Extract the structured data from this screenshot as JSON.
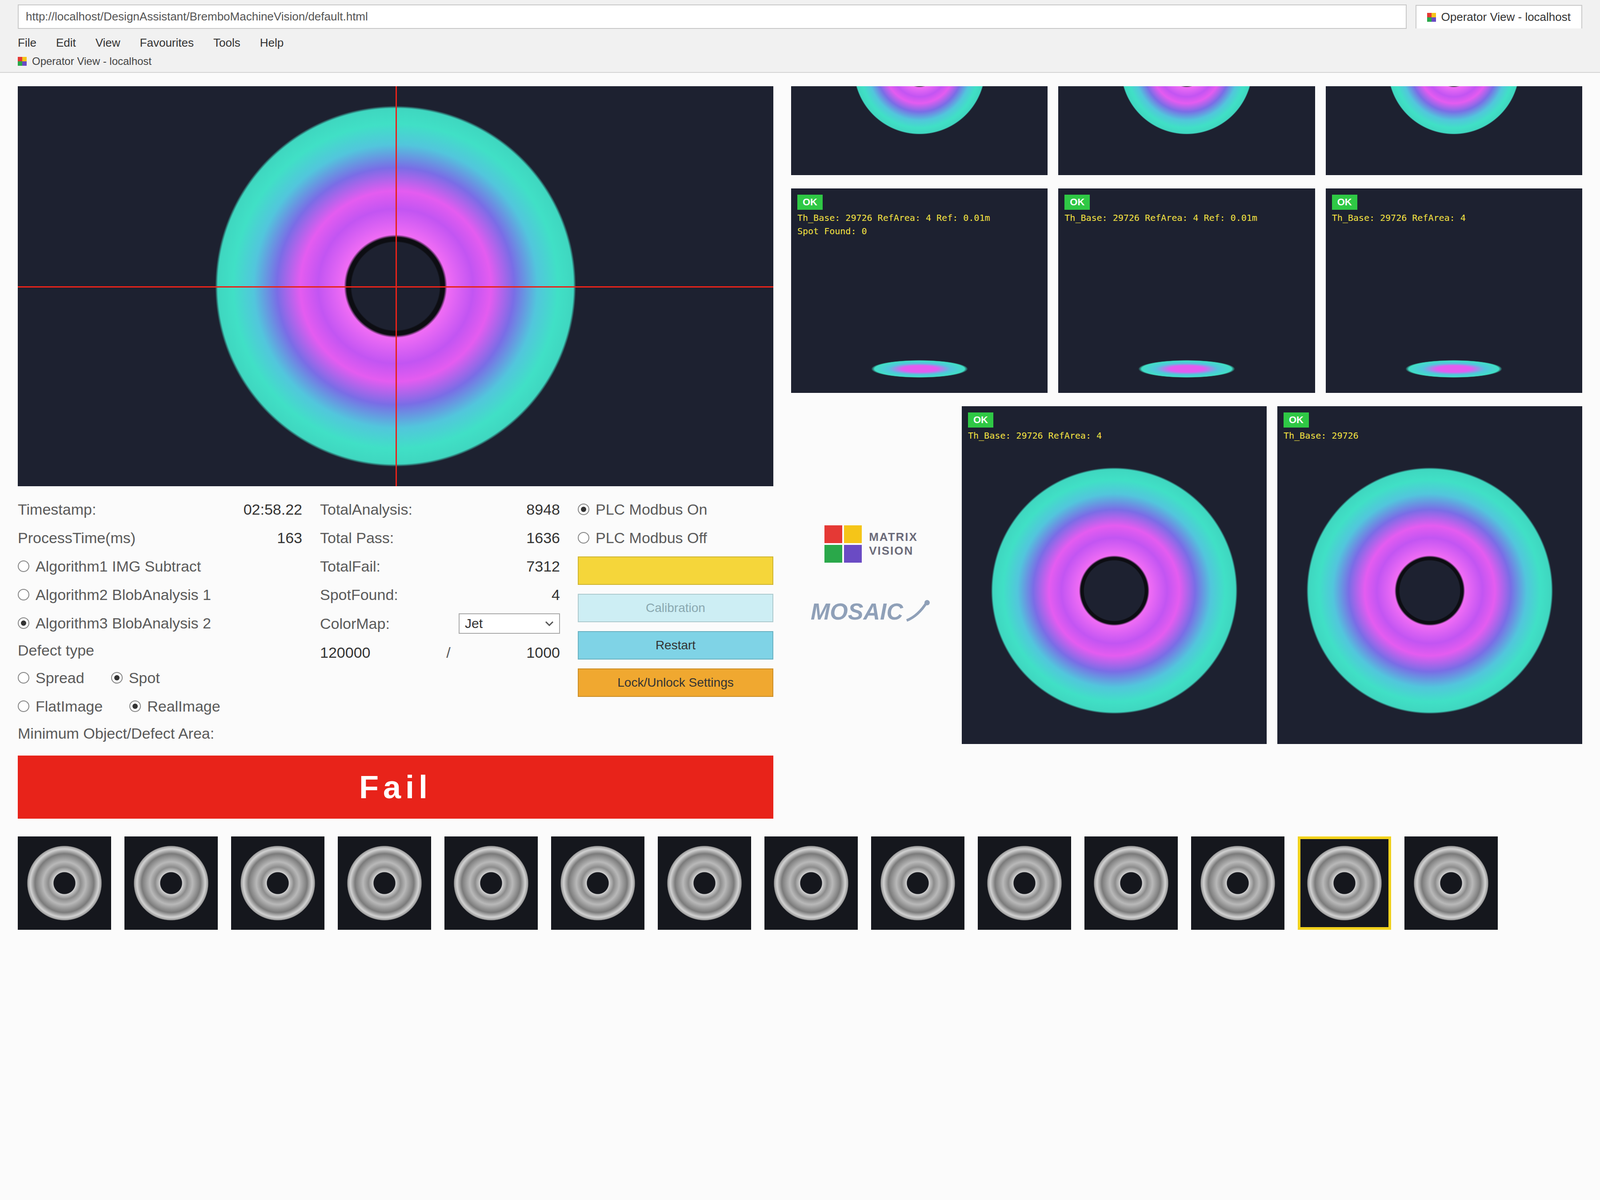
{
  "browser": {
    "address": "http://localhost/DesignAssistant/BremboMachineVision/default.html",
    "tab": "Operator View - localhost",
    "menu": [
      "File",
      "Edit",
      "View",
      "Favourites",
      "Tools",
      "Help"
    ],
    "favorite": "Operator View - localhost"
  },
  "status": [
    {
      "label": "Timestamp:",
      "value": "02:58.22"
    },
    {
      "label": "ProcessTime(ms)",
      "value": "163"
    }
  ],
  "algorithms": [
    {
      "label": "Algorithm1 IMG Subtract",
      "selected": false
    },
    {
      "label": "Algorithm2 BlobAnalysis 1",
      "selected": false
    },
    {
      "label": "Algorithm3 BlobAnalysis 2",
      "selected": true
    }
  ],
  "defect_type": {
    "label": "Defect type",
    "options": [
      {
        "label": "Spread",
        "selected": false
      },
      {
        "label": "Spot",
        "selected": true
      }
    ]
  },
  "image_type": [
    {
      "label": "FlatImage",
      "selected": false
    },
    {
      "label": "RealImage",
      "selected": true
    }
  ],
  "min_area_label": "Minimum Object/Defect Area:",
  "totals": [
    {
      "label": "TotalAnalysis:",
      "value": "8948"
    },
    {
      "label": "Total Pass:",
      "value": "1636"
    },
    {
      "label": "TotalFail:",
      "value": "7312"
    }
  ],
  "spot_found": {
    "label": "SpotFound:",
    "value": "4"
  },
  "color_map": {
    "label": "ColorMap:",
    "value": "Jet"
  },
  "area_values": {
    "max": "120000",
    "separator": "/",
    "min": "1000"
  },
  "plc": [
    {
      "label": "PLC Modbus On",
      "selected": true
    },
    {
      "label": "PLC Modbus Off",
      "selected": false
    }
  ],
  "buttons": [
    {
      "label": "",
      "color": "#f5d63a",
      "disabled": false
    },
    {
      "label": "Calibration",
      "color": "#cdeef4",
      "disabled": true
    },
    {
      "label": "Restart",
      "color": "#7fd3e6",
      "disabled": false
    },
    {
      "label": "Lock/Unlock Settings",
      "color": "#f0a830",
      "disabled": false
    }
  ],
  "result": {
    "label": "Fail",
    "color": "#e8231a"
  },
  "logos": {
    "matrix_top": "MATRIX",
    "matrix_bottom": "VISION",
    "mosaic": "MOSAIC"
  },
  "small_views": [
    {
      "name": "camera-1"
    },
    {
      "name": "camera-2"
    },
    {
      "name": "camera-3"
    }
  ],
  "overlay_views": [
    {
      "badge": "OK",
      "lines": [
        "Th_Base: 29726 RefArea: 4 Ref: 0.01m",
        "Spot Found: 0"
      ]
    },
    {
      "badge": "OK",
      "lines": [
        "Th_Base: 29726 RefArea: 4 Ref: 0.01m"
      ]
    },
    {
      "badge": "OK",
      "lines": [
        "Th_Base: 29726 RefArea: 4"
      ]
    }
  ],
  "ring_views": [
    {
      "badge": "OK",
      "lines": [
        "Th_Base: 29726 RefArea: 4"
      ]
    },
    {
      "badge": "OK",
      "lines": [
        "Th_Base: 29726"
      ]
    }
  ],
  "thumbnails": [
    {
      "selected": false
    },
    {
      "selected": false
    },
    {
      "selected": false
    },
    {
      "selected": false
    },
    {
      "selected": false
    },
    {
      "selected": false
    },
    {
      "selected": false
    },
    {
      "selected": false
    },
    {
      "selected": false
    },
    {
      "selected": false
    },
    {
      "selected": false
    },
    {
      "selected": false
    },
    {
      "selected": true
    },
    {
      "selected": false
    }
  ]
}
